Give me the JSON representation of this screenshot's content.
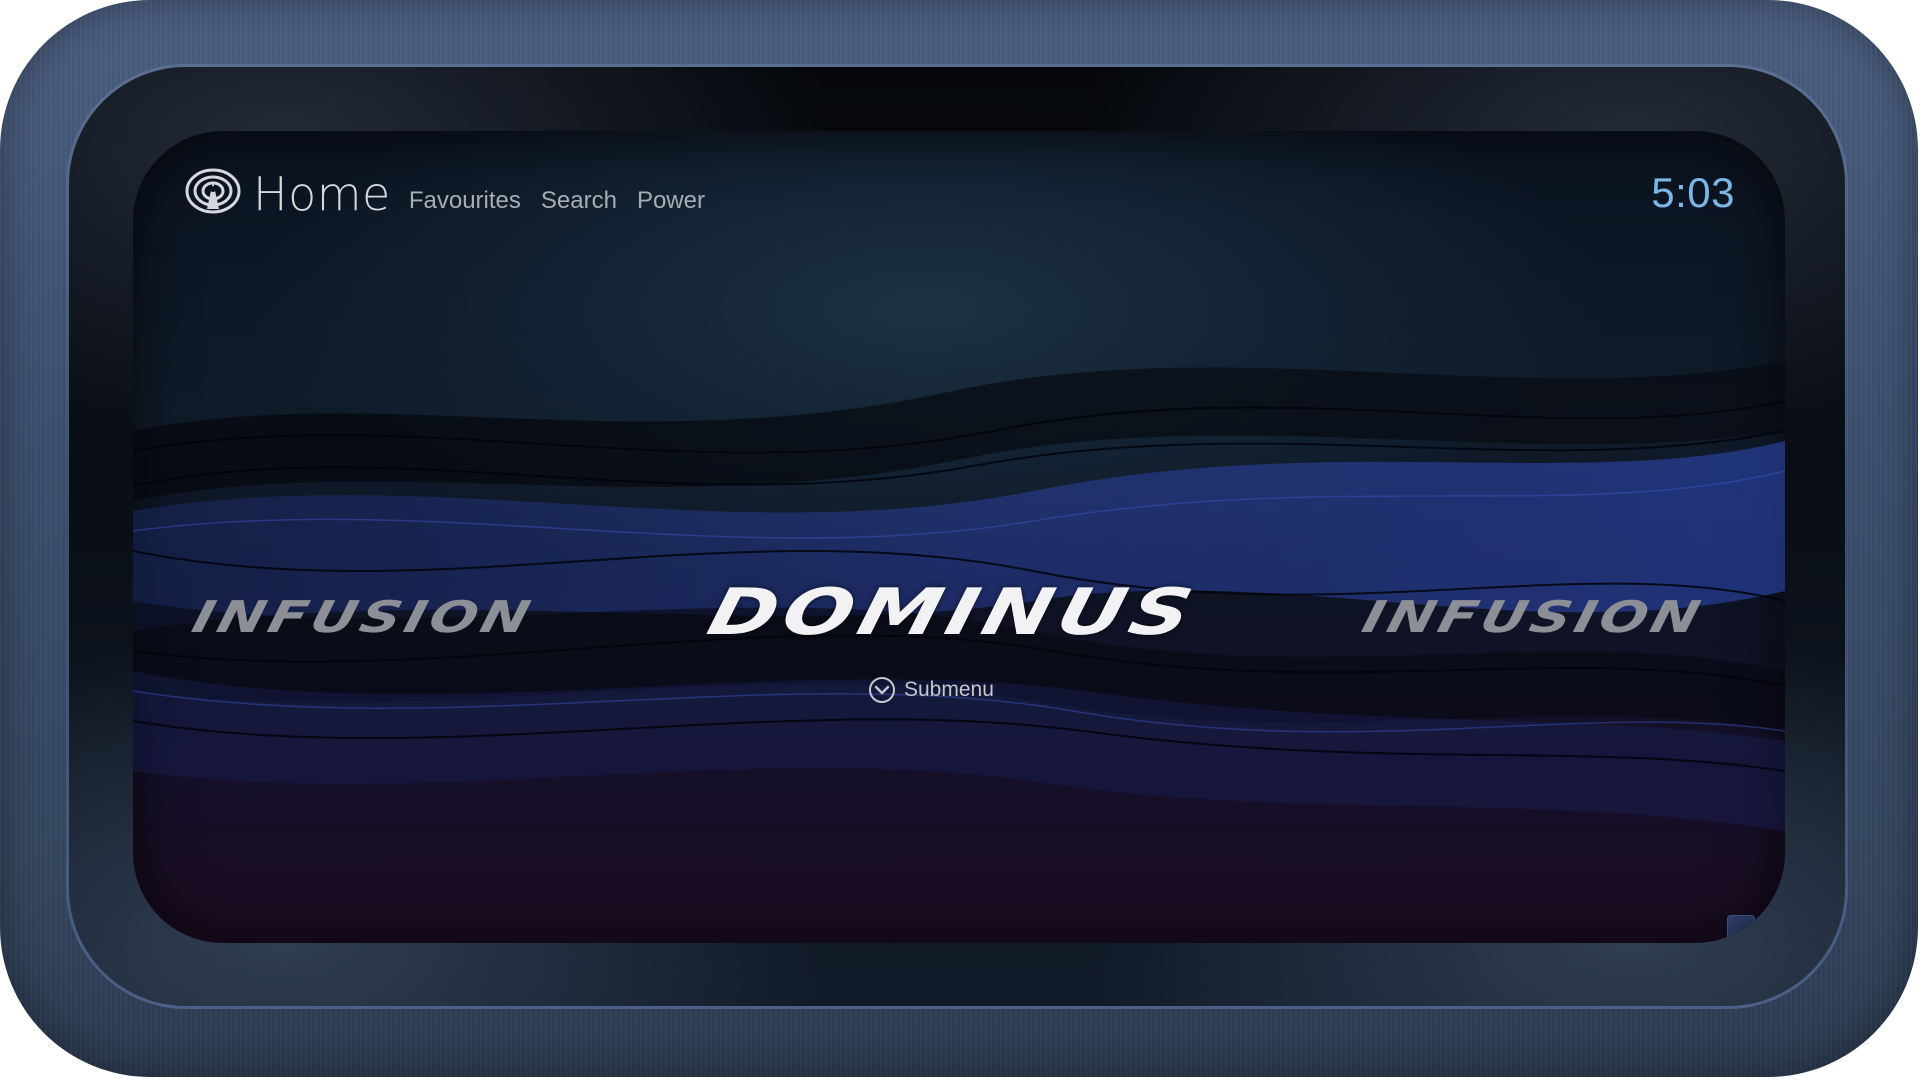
{
  "header": {
    "title": "Home",
    "logo_icon": "home-logo-icon",
    "nav": [
      "Favourites",
      "Search",
      "Power"
    ]
  },
  "clock": "5:03",
  "carousel": {
    "items": [
      "INFUSION",
      "DOMINUS",
      "INFUSION"
    ],
    "selected_index": 1
  },
  "submenu": {
    "label": "Submenu",
    "icon": "chevron-down-circle-icon"
  },
  "colors": {
    "clock": "#7ab7e6",
    "frame": "#3c4f6d",
    "selected_text": "#f2f2f4",
    "unselected_text": "#8c8f96",
    "nav_text": "#a9acb3"
  }
}
